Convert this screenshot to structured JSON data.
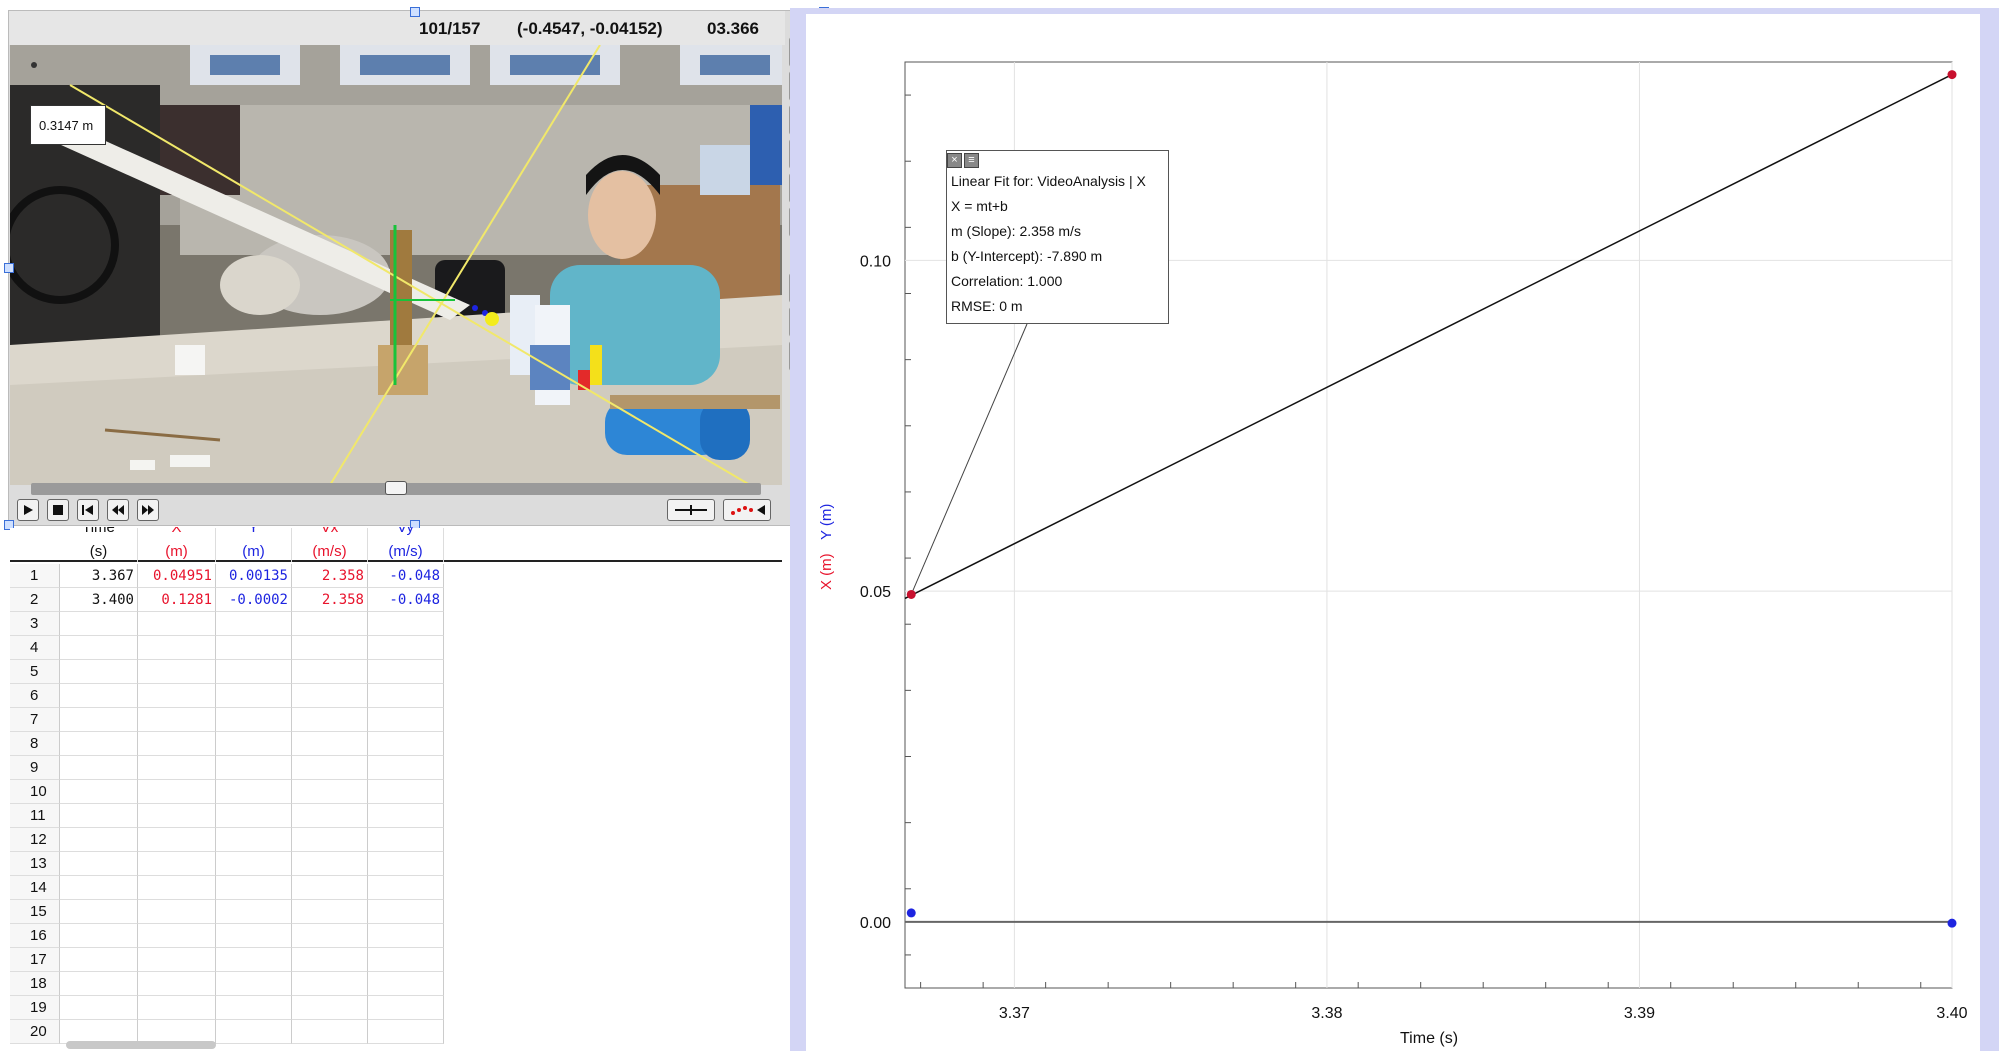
{
  "video": {
    "frame_count": "101/157",
    "cursor_coords": "(-0.4547, -0.04152)",
    "time": "03.366",
    "length_tag": "0.3147 m",
    "scrub_position": 0.5
  },
  "table": {
    "columns": [
      {
        "clip": "Time",
        "unit": "(s)",
        "color": "#111111"
      },
      {
        "clip": "X",
        "unit": "(m)",
        "color": "#e8132c"
      },
      {
        "clip": "Y",
        "unit": "(m)",
        "color": "#1d24e0"
      },
      {
        "clip": "Vx",
        "unit": "(m/s)",
        "color": "#e8132c"
      },
      {
        "clip": "Vy",
        "unit": "(m/s)",
        "color": "#1d24e0"
      }
    ],
    "rows": [
      [
        "3.367",
        "0.04951",
        "0.00135",
        "2.358",
        "-0.048"
      ],
      [
        "3.400",
        "0.1281",
        "-0.0002",
        "2.358",
        "-0.048"
      ]
    ],
    "row_numbers": [
      "1",
      "2",
      "3",
      "4",
      "5",
      "6",
      "7",
      "8",
      "9",
      "10",
      "11",
      "12",
      "13",
      "14",
      "15",
      "16",
      "17",
      "18",
      "19",
      "20"
    ]
  },
  "graph": {
    "y_axis_label_x": "X (m)",
    "y_axis_label_y": "Y (m)",
    "x_axis_label": "Time (s)",
    "x_ticks": [
      "3.37",
      "3.38",
      "3.39",
      "3.40"
    ],
    "y_ticks": [
      "0.00",
      "0.05",
      "0.10"
    ]
  },
  "fit": {
    "title": "Linear Fit for: VideoAnalysis | X",
    "equation": "X = mt+b",
    "slope": "m (Slope): 2.358 m/s",
    "intercept": "b (Y-Intercept): -7.890 m",
    "correlation": "Correlation: 1.000",
    "rmse": "RMSE: 0 m"
  },
  "chart_data": {
    "type": "scatter",
    "xlabel": "Time (s)",
    "ylabel": "X (m)  Y (m)",
    "xlim": [
      3.3665,
      3.4
    ],
    "ylim": [
      -0.01,
      0.13
    ],
    "grid": true,
    "series": [
      {
        "name": "X",
        "color": "#c8102e",
        "x": [
          3.3667,
          3.4
        ],
        "y": [
          0.0495,
          0.1281
        ]
      },
      {
        "name": "Y",
        "color": "#1d24e0",
        "x": [
          3.3667,
          3.4
        ],
        "y": [
          0.00135,
          -0.0002
        ]
      }
    ],
    "fit_line": {
      "x": [
        3.3665,
        3.4
      ],
      "y": [
        0.0489,
        0.1281
      ]
    }
  }
}
